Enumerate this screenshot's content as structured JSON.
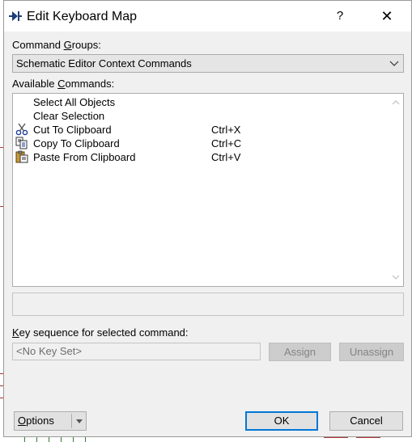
{
  "window": {
    "title": "Edit Keyboard Map",
    "help_glyph": "?",
    "close_glyph": "✕"
  },
  "command_groups": {
    "label_pre": "Command ",
    "label_accel": "G",
    "label_post": "roups:",
    "selected": "Schematic Editor Context Commands"
  },
  "available_commands": {
    "label_pre": "Available ",
    "label_accel": "C",
    "label_post": "ommands:",
    "items": [
      {
        "name": "Select All Objects",
        "key": "",
        "icon": "none"
      },
      {
        "name": "Clear Selection",
        "key": "",
        "icon": "none"
      },
      {
        "name": "Cut To Clipboard",
        "key": "Ctrl+X",
        "icon": "scissors-icon"
      },
      {
        "name": "Copy To Clipboard",
        "key": "Ctrl+C",
        "icon": "copy-icon"
      },
      {
        "name": "Paste From Clipboard",
        "key": "Ctrl+V",
        "icon": "paste-icon"
      }
    ]
  },
  "key_sequence": {
    "label_accel": "K",
    "label_post": "ey sequence for selected command:",
    "value": "<No Key Set>"
  },
  "buttons": {
    "assign": "Assign",
    "unassign": "Unassign",
    "options_accel": "O",
    "options_post": "ptions",
    "ok": "OK",
    "cancel": "Cancel"
  },
  "colors": {
    "dialog_bg": "#f0f0f0",
    "accent": "#0078d7"
  }
}
